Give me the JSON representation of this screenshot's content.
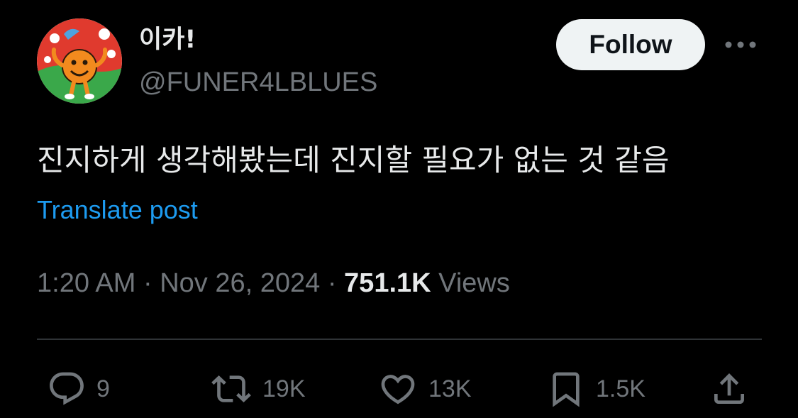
{
  "author": {
    "display_name": "이카!",
    "handle": "@FUNER4LBLUES",
    "avatar_icon": "cartoon-avatar-icon"
  },
  "follow_label": "Follow",
  "more_icon": "more-horizontal-icon",
  "post": {
    "text": "진지하게 생각해봤는데 진지할 필요가 없는 것 같음",
    "translate_label": "Translate post"
  },
  "meta": {
    "time": "1:20 AM",
    "separator": "·",
    "date": "Nov 26, 2024",
    "views_count": "751.1K",
    "views_label": "Views"
  },
  "actions": {
    "replies": "9",
    "reposts": "19K",
    "likes": "13K",
    "bookmarks": "1.5K"
  },
  "colors": {
    "background": "#000000",
    "text_primary": "#e7e9ea",
    "text_secondary": "#71767b",
    "link": "#1d9bf0",
    "follow_button_bg": "#eff3f4",
    "divider": "#2f3336"
  }
}
